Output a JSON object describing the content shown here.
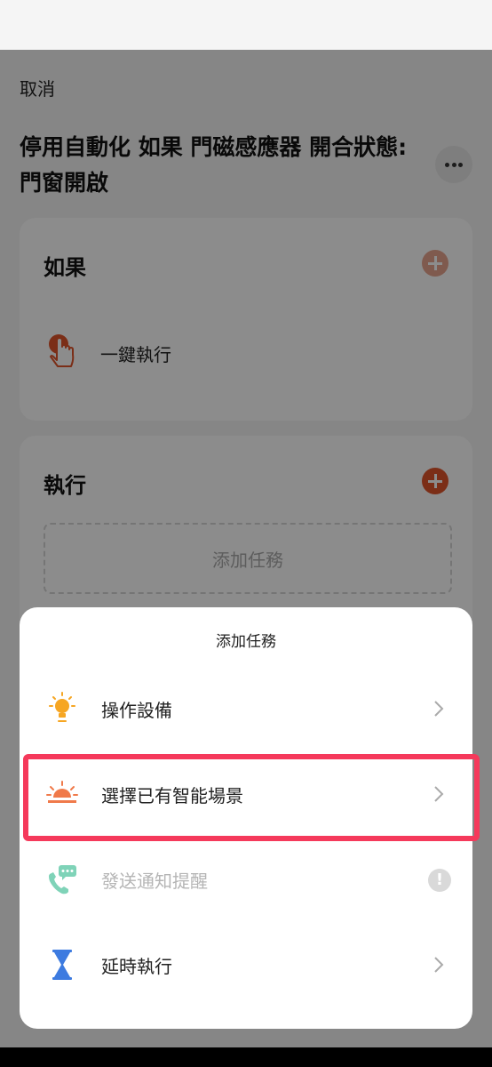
{
  "header": {
    "cancel": "取消",
    "title": "停用自動化 如果 門磁感應器 開合狀態:門窗開啟"
  },
  "if_card": {
    "title": "如果",
    "condition_label": "一鍵執行"
  },
  "do_card": {
    "title": "執行",
    "add_task": "添加任務"
  },
  "sheet": {
    "title": "添加任務",
    "items": [
      {
        "label": "操作設備",
        "icon": "bulb-icon",
        "enabled": true
      },
      {
        "label": "選擇已有智能場景",
        "icon": "sunrise-icon",
        "enabled": true,
        "highlighted": true
      },
      {
        "label": "發送通知提醒",
        "icon": "phone-message-icon",
        "enabled": false
      },
      {
        "label": "延時執行",
        "icon": "hourglass-icon",
        "enabled": true
      }
    ]
  },
  "colors": {
    "accent": "#e0552b",
    "highlight_border": "#f5395b",
    "bulb": "#f6a623",
    "hourglass": "#3d7be0",
    "notify": "#7fd3b8"
  }
}
